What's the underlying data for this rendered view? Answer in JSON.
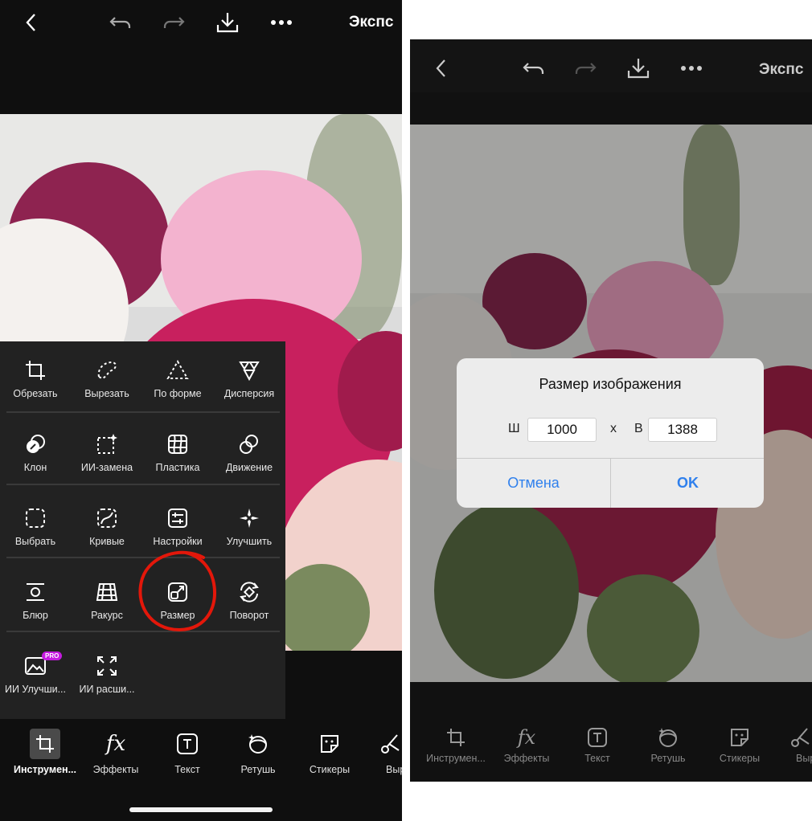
{
  "top_bar": {
    "export_label": "Экспс"
  },
  "tools": {
    "row1": [
      "Обрезать",
      "Вырезать",
      "По форме",
      "Дисперсия"
    ],
    "row2": [
      "Клон",
      "ИИ-замена",
      "Пластика",
      "Движение"
    ],
    "row3": [
      "Выбрать",
      "Кривые",
      "Настройки",
      "Улучшить"
    ],
    "row4": [
      "Блюр",
      "Ракурс",
      "Размер",
      "Поворот"
    ],
    "row5": [
      "ИИ Улучши...",
      "ИИ расши..."
    ],
    "pro_badge": "PRO"
  },
  "bottom_nav_left": [
    "Инструмен...",
    "Эффекты",
    "Текст",
    "Ретушь",
    "Стикеры",
    "Выр"
  ],
  "bottom_nav_right": [
    "Инструмен...",
    "Эффекты",
    "Текст",
    "Ретушь",
    "Стикеры",
    "Выр"
  ],
  "fx_glyph": "fx",
  "dialog": {
    "title": "Размер изображения",
    "width_label": "Ш",
    "width_value": "1000",
    "separator": "x",
    "height_label": "В",
    "height_value": "1388",
    "cancel_label": "Отмена",
    "ok_label": "OK"
  },
  "colors": {
    "accent_blue": "#2f80ed",
    "annotation_red": "#e3170a",
    "pro_purple": "#c51ae0"
  }
}
